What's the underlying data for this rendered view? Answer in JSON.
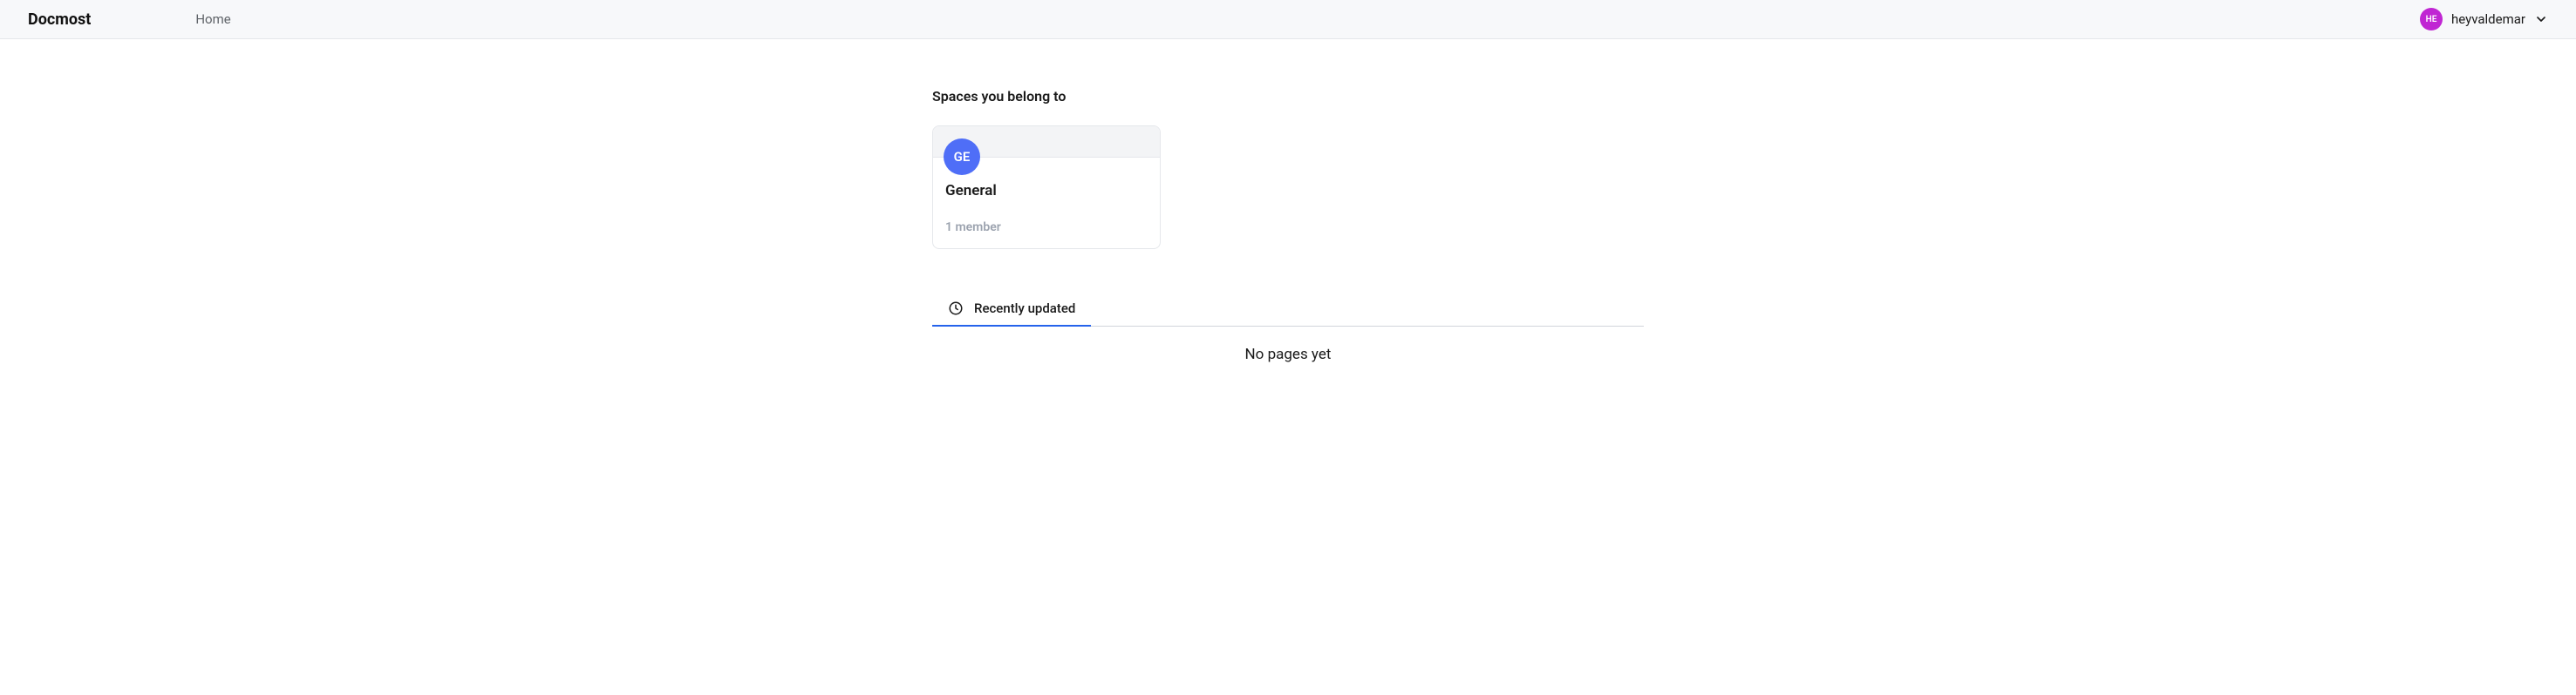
{
  "header": {
    "brand": "Docmost",
    "nav": {
      "home": "Home"
    },
    "user": {
      "avatar_initials": "HE",
      "name": "heyvaldemar"
    }
  },
  "main": {
    "section_title": "Spaces you belong to",
    "spaces": [
      {
        "avatar_initials": "GE",
        "name": "General",
        "members": "1 member"
      }
    ],
    "tabs": [
      {
        "label": "Recently updated"
      }
    ],
    "empty_state": "No pages yet"
  }
}
